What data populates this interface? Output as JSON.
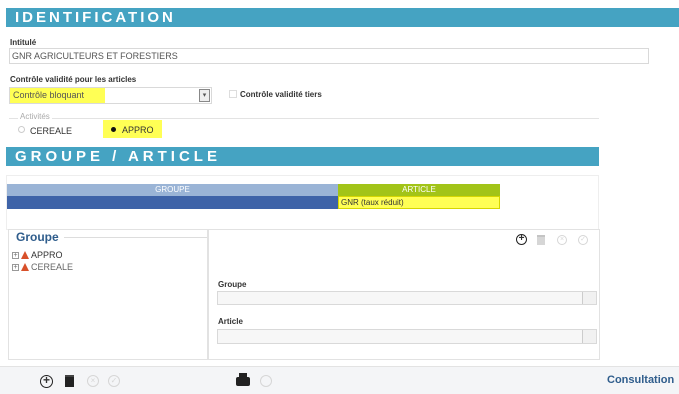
{
  "identification": {
    "header": "IDENTIFICATION",
    "intitule_label": "Intitulé",
    "intitule_value": "GNR AGRICULTEURS ET FORESTIERS",
    "controle_label": "Contrôle validité pour les articles",
    "controle_value": "Contrôle bloquant",
    "controle_tiers_label": "Contrôle validité tiers",
    "activites_label": "Activités",
    "activites": [
      "CEREALE",
      "APPRO"
    ]
  },
  "groupe_article": {
    "header": "GROUPE / ARTICLE",
    "col_groupe": "GROUPE",
    "col_article": "ARTICLE",
    "row_article": "GNR (taux réduit)"
  },
  "tree": {
    "title": "Groupe",
    "items": [
      "APPRO",
      "CEREALE"
    ]
  },
  "form": {
    "groupe_label": "Groupe",
    "article_label": "Article"
  },
  "footer": {
    "consultation": "Consultation"
  },
  "colors": {
    "section_bar": "#45a3c2",
    "highlight": "#ffff55",
    "groupe_header": "#9ab4d6",
    "article_header": "#a2c418",
    "selected_row": "#3e63a8"
  }
}
